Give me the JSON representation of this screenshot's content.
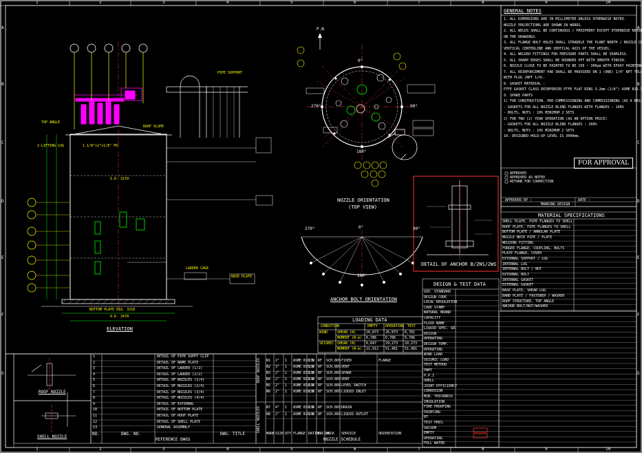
{
  "border_numbers": [
    "1",
    "2",
    "3",
    "4",
    "5",
    "6",
    "7",
    "8",
    "9",
    "10"
  ],
  "border_letters": [
    "A",
    "B",
    "C",
    "D",
    "E",
    "F",
    "G"
  ],
  "titles": {
    "elevation": "ELEVATION",
    "nozzle_orientation": "NOZZLE ORIENTATION",
    "top_view": "(TOP VIEW)",
    "anchor_bolt": "ANCHOR BOLT ORIENTATION",
    "detail_anchor": "DETAIL OF ANCHOR B/2NS/2WS",
    "loading_data": "LOADING DATA",
    "design_test": "DESIGN & TEST DATA",
    "material_spec": "MATERIAL SPECIFICATIONS",
    "general_notes": "GENERAL NOTES",
    "for_approval": "FOR APPROVAL",
    "reference_dwgs": "REFERENCE DWGS",
    "nozzle_schedule": "NOZZLE SCHEDULE",
    "roof_nozzle": "ROOF NOZZLE",
    "shell_nozzle": "SHELL NOZZLE"
  },
  "angles": {
    "top": "0°",
    "right": "90°",
    "bottom": "180°",
    "left": "270°",
    "pn": "P.N"
  },
  "approval_box": {
    "opt1": "APPROVED",
    "opt2": "APPROVED AS NOTED",
    "opt3": "RETURN FOR CORRECTION",
    "approved_by": "APPROVED BY :",
    "date": "DATE :"
  },
  "loading_table": {
    "headers": [
      "CONDITION",
      "EMPTY",
      "OPERATING",
      "TEST"
    ],
    "rows": [
      [
        "WIND",
        "SHEAR (N)",
        "26,873",
        "26,873",
        "6,781"
      ],
      [
        "",
        "MOMENT (N-m)",
        "6,786",
        "6,786",
        "6,786"
      ],
      [
        "SEISMIC",
        "SHEAR (N)",
        "6,647",
        "29,273",
        "29,273"
      ],
      [
        "",
        "MOMENT (N-m)",
        "21,912",
        "51,481",
        "51,481"
      ]
    ]
  },
  "material_rows": [
    "SHELL PLATE, PIPE FLANGES TO SHELL",
    "ROOF PLATE, PIPE FLANGES TO SHELL",
    "BOTTOM PLATE / ANNULAR PLATE",
    "NOZZLE NECK PIPE / PLATE",
    "WELDING FITTING",
    "FORGED FLANGE, COUPLING, BOLTS",
    "PLATE FLANGE, COVER",
    "EXTERNAL SUPPORT / LUG",
    "INTERNAL LUG",
    "INTERNAL BOLT / NUT",
    "EXTERNAL BOLT",
    "INTERNAL GASKET",
    "EXTERNAL GASKET",
    "BASE PLATE, SHEAR LUG",
    "BAND PLATE / FASTENER / WASHER",
    "ROOF STRUCTURE, TOP ANGLE",
    "ANCHOR BOLT/NUT/WASHER"
  ],
  "design_rows": [
    "GOV. STANDARD",
    "DESIGN CODE",
    "LOCAL REGULATION",
    "CODE STAMP",
    "NATURAL BRAND",
    "CAPACITY",
    "FLUID NAME",
    "LIQUID SPEC. GR.",
    "DESIGN",
    "OPERATING",
    "DESIGN TEMP.",
    "OPERATING",
    "WIND LOAD",
    "SEISMIC LOAD",
    "TEST METHOD",
    "PWHT",
    "P.P.I",
    "SHELL",
    "JOINT EFFICIENCY",
    "CORROSION",
    "MIN. THICKNESS",
    "INSULATION",
    "FIRE PROOFING",
    "PAINTING",
    "RT",
    "TEST PRES.",
    "VACUUM",
    "EMPTY",
    "OPERATING",
    "FULL WATER"
  ],
  "reference_rows": [
    "DETAIL OF PIPE SUPPT CLIP",
    "DETAIL OF NAME PLATE",
    "DETAIL OF LADDER (1/2)",
    "DETAIL OF LADDER (2/2)",
    "DETAIL OF NOZZLES (1/4)",
    "DETAIL OF NOZZLES (2/4)",
    "DETAIL OF NOZZLES (3/4)",
    "DETAIL OF NOZZLES (4/4)",
    "DETAIL OF EXTERNAL",
    "DETAIL OF BOTTOM PLATE",
    "DETAIL OF ROOF PLATE",
    "DETAIL OF SHELL PLATE",
    "GENERAL ASSEMBLY"
  ],
  "reference_header": {
    "no": "NO.",
    "dwg": "DWG. NO.",
    "title": "DWG. TITLE"
  },
  "nozzle_section_labels": {
    "roof": "ROOF NOZZLES",
    "shell": "SHELL NOZZLES"
  },
  "nozzle_rows": [
    [
      "N1",
      "2\"",
      "1",
      "ASME B16.5",
      "150",
      "RF",
      "SCH.80S",
      "FIXED",
      "FLANGE"
    ],
    [
      "N2",
      "3\"",
      "1",
      "ASME B16.5",
      "150",
      "RF",
      "SCH.80S",
      "VENT",
      ""
    ],
    [
      "N3",
      "2\"",
      "1",
      "ASME B16.5",
      "150",
      "RF",
      "SCH.80S",
      "SPARE",
      ""
    ],
    [
      "N4",
      "2\"",
      "1",
      "ASME B16.5",
      "150",
      "RF",
      "SCH.80S",
      "VENT",
      ""
    ],
    [
      "N5",
      "2\"",
      "1",
      "ASME B16.5",
      "150",
      "RF",
      "SCH.80S",
      "LEVEL SWITCH",
      ""
    ],
    [
      "N6",
      "2\"",
      "1",
      "ASME B16.5",
      "150",
      "RF",
      "SCH.80S",
      "LIQUID INLET",
      ""
    ],
    [
      "N7",
      "4\"",
      "1",
      "ASME B16.5",
      "150",
      "RF",
      "SCH.80S",
      "DRAIN",
      ""
    ],
    [
      "N8",
      "2\"",
      "1",
      "ASME B16.5",
      "150",
      "RF",
      "SCH.80S",
      "LIQUID OUTLET",
      ""
    ]
  ],
  "nozzle_headers": [
    "MARK",
    "SIZE",
    "QTY",
    "FLANGE",
    "RATING",
    "FACING",
    "NECK",
    "SERVICE",
    "ORIENTATION"
  ],
  "general_notes": [
    "1. ALL DIMENSIONS ARE IN MILLIMETER UNLESS OTHERWISE NOTED.",
    "   NOZZLE PROJECTIONS ARE SHOWN IN WORDS.",
    "2. ALL WELDS SHALL BE CONTINUOUS / PERIPHERY EXCEPT OTHERWISE NOTED",
    "   ON THE DRAWINGS.",
    "3. ALL FLANGE BOLT HOLES SHALL STRADDLE THE PLANT NORTH / NOZZLE CENTER LINE OR",
    "   VERTICAL CENTERLINE AND VERTICAL AXIS OF THE VESSEL.",
    "4. ALL WELDED FITTINGS FOR PRESSURE PARTS SHALL BE SEAMLESS.",
    "5. ALL SHARP EDGES SHALL BE ROUNDED OFF WITH SMOOTH FINISH.",
    "6. NOZZLE CLOSE TO BE PAINTED TO BE 150 ~ 300μm WITH EPOXY PAINTING.",
    "7. ALL REINFORCEMENT PAD SHALL BE PROVIDED ON 1 (ONE) 1/4\" NPT TELL-TALE HOLE",
    "   WITH PLUG (NPT 1/4).",
    "8. GASKET MATERIAL :",
    "   PTFE GASKET CLASS REINFORCED PTFE FLAT RING 3.2mm (1/8\") ASME B16.21 ASME B16.5",
    "9. SPARE PARTS",
    "   1) FOR CONSTRUCTION, PRE-COMMISSIONING AND COMMISSIONING (AS A BASIC PRICE)",
    "    - GASKETS FOR ALL NOZZLE BLIND FLANGES WITH FLANGES : 100%",
    "    - BOLTS, NUTS : 10% MINIMUM 2 SETS",
    "   2) FOR TWO (2) YEAR OPERATION (AS AN OPTION PRICE)",
    "    - GASKETS FOR ALL NOZZLE BLIND FLANGES : 200%",
    "    - BOLTS, NUTS : 10% MINIMUM 2 SETS",
    "10. DESIGNED HOLD-UP LEVEL IS 3000mm."
  ],
  "side_labels": {
    "top_angle": "TOP ANGLE",
    "lifting_lug": "2-LIFTING LUG",
    "top_angle_ref": "1.1/8\"x2\"x1/8\" FR.",
    "pipe_support": "PIPE SUPPORT",
    "roof_slope": "ROOF SLOPE",
    "bottom_plate": "BOTTOM PLATE DIA. 3210",
    "base_plate": "BASE PLATE",
    "ladder_cage": "LADDER CAGE",
    "spec_left": "STAMP SPEC",
    "design_data": "DESIGN DATA",
    "approval_stamp": "MARKING DESIGN"
  },
  "dimensions": {
    "od": "O.D. 3470",
    "dia_bottom": "DIA. 3210",
    "id": "I.D. 3210"
  }
}
